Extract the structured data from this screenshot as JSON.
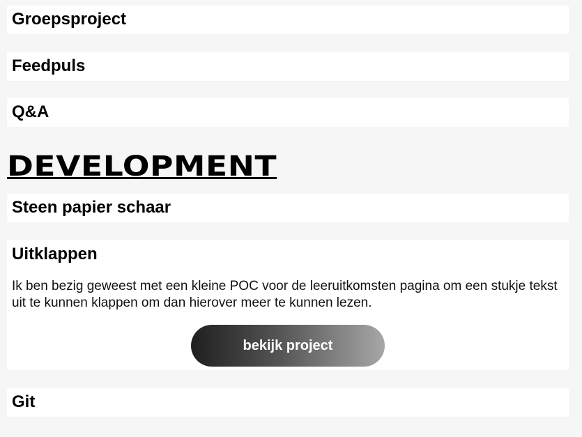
{
  "projects_before": [
    {
      "title": "Groepsproject"
    },
    {
      "title": "Feedpuls"
    },
    {
      "title": "Q&A"
    }
  ],
  "section": {
    "heading": "DEVELOPMENT"
  },
  "projects_after": [
    {
      "title": "Steen papier schaar"
    },
    {
      "title": "Uitklappen",
      "description": "Ik ben bezig geweest met een kleine POC voor de leeruitkomsten pagina om een stukje tekst uit te kunnen klappen om dan hierover meer te kunnen lezen.",
      "button_label": "bekijk project"
    },
    {
      "title": "Git"
    }
  ]
}
